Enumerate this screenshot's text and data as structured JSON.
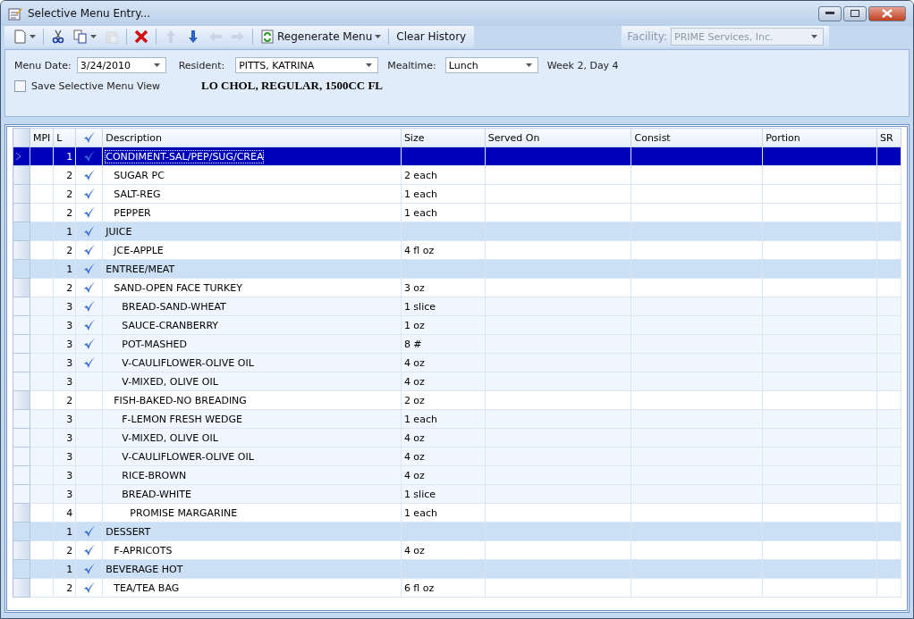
{
  "window": {
    "title": "Selective Menu Entry..."
  },
  "toolbar": [
    {
      "kind": "new",
      "dropdown": true,
      "disabled": false
    },
    {
      "kind": "sep"
    },
    {
      "kind": "cut",
      "dropdown": false,
      "disabled": false
    },
    {
      "kind": "copy",
      "dropdown": true,
      "disabled": false
    },
    {
      "kind": "paste",
      "dropdown": false,
      "disabled": true
    },
    {
      "kind": "sep"
    },
    {
      "kind": "delete",
      "dropdown": false,
      "disabled": false
    },
    {
      "kind": "sep"
    },
    {
      "kind": "up",
      "dropdown": false,
      "disabled": true
    },
    {
      "kind": "down",
      "dropdown": false,
      "disabled": false
    },
    {
      "kind": "left",
      "dropdown": false,
      "disabled": true
    },
    {
      "kind": "right",
      "dropdown": false,
      "disabled": true
    },
    {
      "kind": "sep"
    },
    {
      "kind": "regenerate",
      "label": "Regenerate Menu",
      "dropdown": true,
      "disabled": false
    },
    {
      "kind": "sep"
    },
    {
      "kind": "text",
      "label": "Clear History",
      "dropdown": false,
      "disabled": false
    }
  ],
  "facility": {
    "label": "Facility:",
    "value": "PRIME Services, Inc.",
    "disabled": true
  },
  "form": {
    "menu_date": {
      "label": "Menu Date:",
      "value": "3/24/2010"
    },
    "resident": {
      "label": "Resident:",
      "value": "PITTS, KATRINA"
    },
    "mealtime": {
      "label": "Mealtime:",
      "value": "Lunch"
    },
    "week_day": "Week 2, Day 4",
    "save_view": {
      "label": "Save Selective Menu View",
      "checked": false
    },
    "diet": "LO CHOL, REGULAR, 1500CC FL"
  },
  "table": {
    "columns": [
      {
        "kind": "text",
        "label": "MPI"
      },
      {
        "kind": "text",
        "label": "L"
      },
      {
        "kind": "check"
      },
      {
        "kind": "text",
        "label": "Description"
      },
      {
        "kind": "text",
        "label": "Size"
      },
      {
        "kind": "text",
        "label": "Served On"
      },
      {
        "kind": "text",
        "label": "Consist"
      },
      {
        "kind": "text",
        "label": "Portion"
      },
      {
        "kind": "text",
        "label": "SR"
      }
    ],
    "rows": [
      {
        "l": "1",
        "checked": true,
        "selected": true,
        "description": "CONDIMENT-SAL/PEP/SUG/CREA",
        "children": [
          {
            "l": "2",
            "checked": true,
            "selected": false,
            "description": "SUGAR PC",
            "size": "2 each"
          },
          {
            "l": "2",
            "checked": true,
            "selected": false,
            "description": "SALT-REG",
            "size": "1 each"
          },
          {
            "l": "2",
            "checked": true,
            "selected": false,
            "description": "PEPPER",
            "size": "1 each"
          }
        ]
      },
      {
        "l": "1",
        "checked": true,
        "selected": false,
        "description": "JUICE",
        "children": [
          {
            "l": "2",
            "checked": true,
            "selected": false,
            "description": "JCE-APPLE",
            "size": "4 fl oz"
          }
        ]
      },
      {
        "l": "1",
        "checked": true,
        "selected": false,
        "description": "ENTREE/MEAT",
        "children": [
          {
            "l": "2",
            "checked": true,
            "selected": false,
            "description": "SAND-OPEN FACE TURKEY",
            "size": "3 oz",
            "children": [
              {
                "l": "3",
                "checked": true,
                "selected": false,
                "description": "BREAD-SAND-WHEAT",
                "size": "1 slice"
              },
              {
                "l": "3",
                "checked": true,
                "selected": false,
                "description": "SAUCE-CRANBERRY",
                "size": "1 oz"
              },
              {
                "l": "3",
                "checked": true,
                "selected": false,
                "description": "POT-MASHED",
                "size": "8 #"
              },
              {
                "l": "3",
                "checked": true,
                "selected": false,
                "description": "V-CAULIFLOWER-OLIVE OIL",
                "size": "4 oz"
              },
              {
                "l": "3",
                "checked": false,
                "selected": false,
                "description": "V-MIXED, OLIVE OIL",
                "size": "4 oz"
              }
            ]
          },
          {
            "l": "2",
            "checked": false,
            "selected": false,
            "description": "FISH-BAKED-NO BREADING",
            "size": "2 oz",
            "children": [
              {
                "l": "3",
                "checked": false,
                "selected": false,
                "description": "F-LEMON FRESH WEDGE",
                "size": "1 each"
              },
              {
                "l": "3",
                "checked": false,
                "selected": false,
                "description": "V-MIXED, OLIVE OIL",
                "size": "4 oz"
              },
              {
                "l": "3",
                "checked": false,
                "selected": false,
                "description": "V-CAULIFLOWER-OLIVE OIL",
                "size": "4 oz"
              },
              {
                "l": "3",
                "checked": false,
                "selected": false,
                "description": "RICE-BROWN",
                "size": "4 oz"
              },
              {
                "l": "3",
                "checked": false,
                "selected": false,
                "description": "BREAD-WHITE",
                "size": "1 slice",
                "children": [
                  {
                    "l": "4",
                    "checked": false,
                    "selected": false,
                    "description": "PROMISE MARGARINE",
                    "size": "1 each"
                  }
                ]
              }
            ]
          }
        ]
      },
      {
        "l": "1",
        "checked": true,
        "selected": false,
        "description": "DESSERT",
        "children": [
          {
            "l": "2",
            "checked": true,
            "selected": false,
            "description": "F-APRICOTS",
            "size": "4 oz"
          }
        ]
      },
      {
        "l": "1",
        "checked": true,
        "selected": false,
        "description": "BEVERAGE HOT",
        "children": [
          {
            "l": "2",
            "checked": true,
            "selected": false,
            "description": "TEA/TEA BAG",
            "size": "6 fl oz"
          }
        ]
      }
    ]
  }
}
